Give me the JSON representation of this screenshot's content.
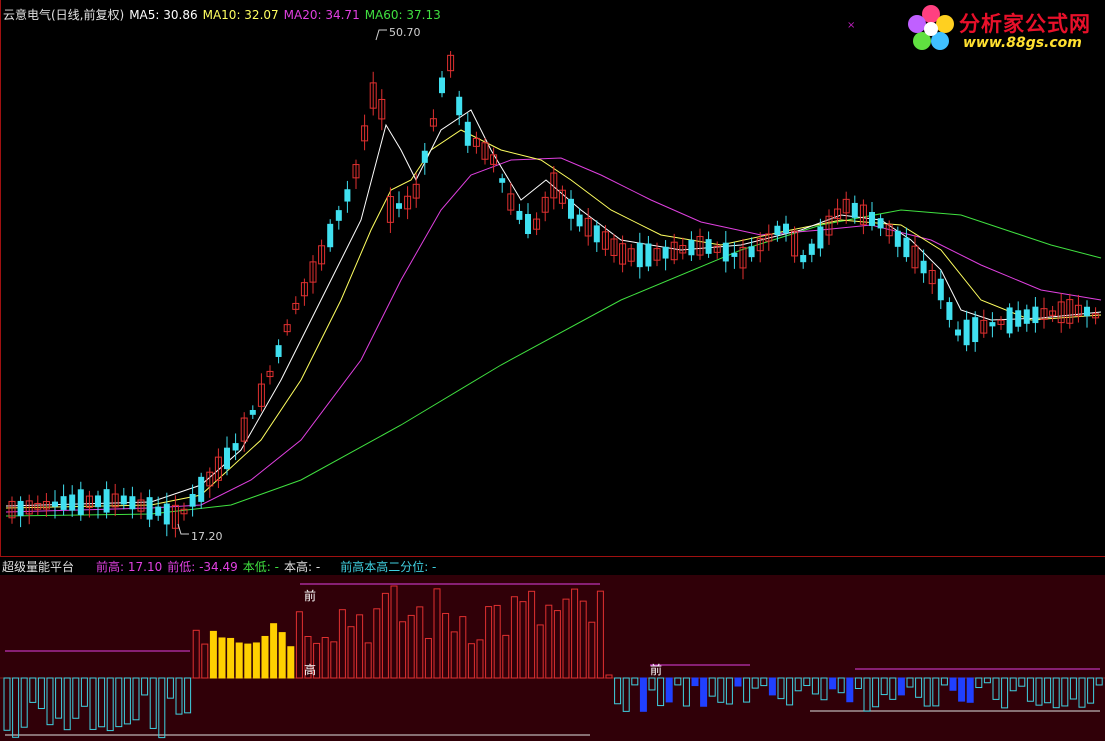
{
  "main_header": {
    "stock": "云意电气(日线,前复权)",
    "ma5": "MA5: 30.86",
    "ma10": "MA10: 32.07",
    "ma20": "MA20: 34.71",
    "ma60": "MA60: 37.13"
  },
  "sub_header": {
    "name": "超级量能平台",
    "prev_high": "前高: 17.10",
    "prev_low": "前低: -34.49",
    "this_low": "本低: -",
    "this_high": "本高: -",
    "second_quantile": "前高本高二分位: -"
  },
  "price_labels": {
    "high": "50.70",
    "low": "17.20"
  },
  "markers": {
    "qian": "前",
    "gao": "高"
  },
  "close_mark": "×",
  "logo": {
    "cn": "分析家公式网",
    "url": "www.88gs.com"
  },
  "colors": {
    "up": "#e03030",
    "down": "#40e0f0",
    "ma5": "#ffffff",
    "ma10": "#ffff60",
    "ma20": "#e040e0",
    "ma60": "#40e040",
    "vol_up": "#e03030",
    "vol_yellow": "#ffd000",
    "vol_neg": "#40d0e0",
    "vol_blue": "#2040ff"
  },
  "chart_data": {
    "type": "candlestick",
    "ylim": [
      17.2,
      50.7
    ],
    "highest": 50.7,
    "lowest": 17.2,
    "ma_values": {
      "MA5": 30.86,
      "MA10": 32.07,
      "MA20": 34.71,
      "MA60": 37.13
    }
  }
}
